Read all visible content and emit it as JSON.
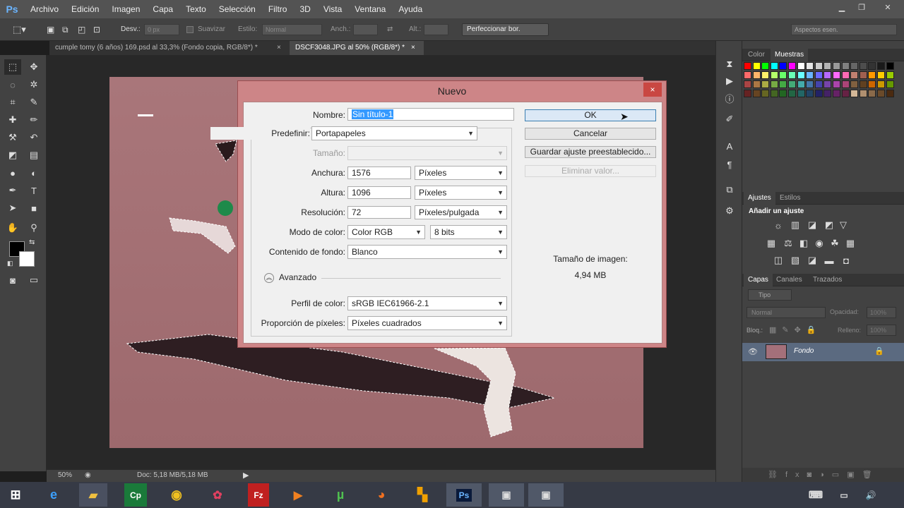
{
  "menubar": {
    "logo": "Ps",
    "items": [
      "Archivo",
      "Edición",
      "Imagen",
      "Capa",
      "Texto",
      "Selección",
      "Filtro",
      "3D",
      "Vista",
      "Ventana",
      "Ayuda"
    ]
  },
  "options": {
    "desv_label": "Desv.:",
    "desv_value": "0 px",
    "suavizar": "Suavizar",
    "estilo_label": "Estilo:",
    "estilo_value": "Normal",
    "anch_label": "Anch.:",
    "alt_label": "Alt.:",
    "perfeccionar": "Perfeccionar bor.",
    "workspace": "Aspectos esen."
  },
  "tabs": [
    {
      "label": "cumple tomy (6 años) 169.psd al 33,3% (Fondo copia, RGB/8*) *",
      "close": "×"
    },
    {
      "label": "DSCF3048.JPG al 50% (RGB/8*) *",
      "close": "×"
    }
  ],
  "status": {
    "zoom": "50%",
    "doc": "Doc: 5,18 MB/5,18 MB"
  },
  "dialog": {
    "title": "Nuevo",
    "close": "×",
    "nombre_label": "Nombre:",
    "nombre_value": "Sin título-1",
    "predefinir_label": "Predefinir:",
    "predefinir_value": "Portapapeles",
    "tamano_label": "Tamaño:",
    "anchura_label": "Anchura:",
    "anchura_value": "1576",
    "anchura_unit": "Píxeles",
    "altura_label": "Altura:",
    "altura_value": "1096",
    "altura_unit": "Píxeles",
    "resolucion_label": "Resolución:",
    "resolucion_value": "72",
    "resolucion_unit": "Píxeles/pulgada",
    "modo_label": "Modo de color:",
    "modo_value": "Color RGB",
    "modo_bits": "8 bits",
    "fondo_label": "Contenido de fondo:",
    "fondo_value": "Blanco",
    "avanzado_label": "Avanzado",
    "perfil_label": "Perfil de color:",
    "perfil_value": "sRGB IEC61966-2.1",
    "proporcion_label": "Proporción de píxeles:",
    "proporcion_value": "Píxeles cuadrados",
    "ok": "OK",
    "cancelar": "Cancelar",
    "guardar": "Guardar ajuste preestablecido...",
    "eliminar": "Eliminar valor...",
    "tamano_imagen_label": "Tamaño de imagen:",
    "tamano_imagen_value": "4,94 MB"
  },
  "panels": {
    "color_tab": "Color",
    "muestras_tab": "Muestras",
    "ajustes_tab": "Ajustes",
    "estilos_tab": "Estilos",
    "anadir": "Añadir un ajuste",
    "capas_tab": "Capas",
    "canales_tab": "Canales",
    "trazados_tab": "Trazados",
    "tipo": "Tipo",
    "blend": "Normal",
    "opacidad_label": "Opacidad:",
    "opacidad_value": "100%",
    "bloq_label": "Bloq.:",
    "relleno_label": "Relleno:",
    "relleno_value": "100%",
    "layer_name": "Fondo"
  },
  "colors": {
    "accent": "#6bb5ff",
    "dialog_frame": "#cd8587",
    "selection": "#3399ff"
  }
}
